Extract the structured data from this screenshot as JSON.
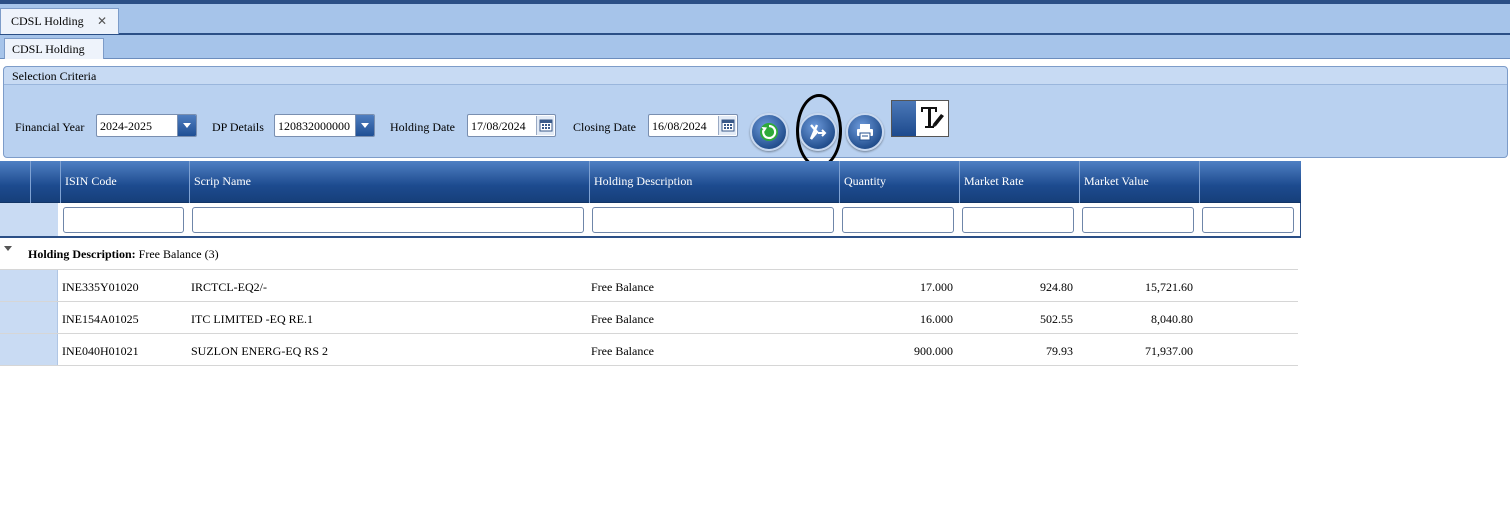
{
  "window_tab": {
    "label": "CDSL Holding",
    "close_symbol": "✕"
  },
  "sub_tab": {
    "label": "CDSL Holding"
  },
  "criteria": {
    "title": "Selection Criteria",
    "financial_year": {
      "label": "Financial Year",
      "value": "2024-2025"
    },
    "dp_details": {
      "label": "DP Details",
      "value": "120832000000"
    },
    "holding_date": {
      "label": "Holding Date",
      "value": "17/08/2024"
    },
    "closing_date": {
      "label": "Closing Date",
      "value": "16/08/2024"
    }
  },
  "toolbar": {
    "refresh_icon": "refresh-icon",
    "export_icon": "export-icon",
    "print_icon": "print-icon",
    "text_format_icon": "text-edit-icon"
  },
  "grid": {
    "columns": [
      "ISIN Code",
      "Scrip Name",
      "Holding Description",
      "Quantity",
      "Market Rate",
      "Market Value"
    ],
    "group": {
      "label": "Holding Description:",
      "value": "Free Balance (3)"
    },
    "rows": [
      {
        "isin": "INE335Y01020",
        "scrip": "IRCTCL-EQ2/-",
        "desc": "Free Balance",
        "qty": "17.000",
        "rate": "924.80",
        "value": "15,721.60"
      },
      {
        "isin": "INE154A01025",
        "scrip": "ITC LIMITED -EQ RE.1",
        "desc": "Free Balance",
        "qty": "16.000",
        "rate": "502.55",
        "value": "8,040.80"
      },
      {
        "isin": "INE040H01021",
        "scrip": "SUZLON ENERG-EQ RS 2",
        "desc": "Free Balance",
        "qty": "900.000",
        "rate": "79.93",
        "value": "71,937.00"
      }
    ]
  },
  "colors": {
    "header_blue": "#1d4b8f",
    "panel_blue": "#b9d1f0",
    "tab_bar": "#a6c4ea"
  }
}
